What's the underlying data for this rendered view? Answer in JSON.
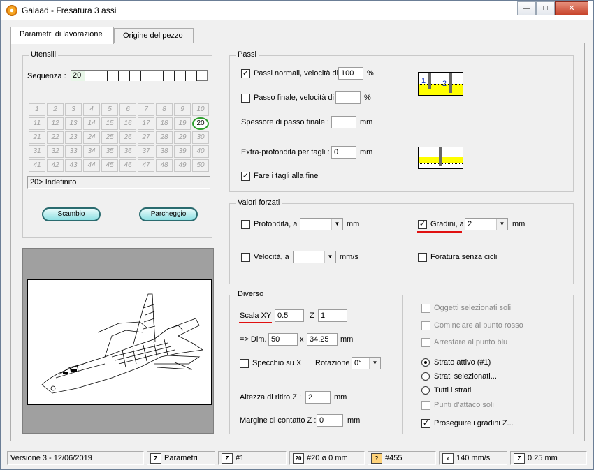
{
  "window": {
    "title": "Galaad  -  Fresatura 3 assi",
    "buttons": {
      "minimize": "—",
      "maximize": "□",
      "close": "✕"
    }
  },
  "tabs": [
    {
      "label": "Parametri di lavorazione",
      "active": true
    },
    {
      "label": "Origine del pezzo",
      "active": false
    }
  ],
  "utensili": {
    "title": "Utensili",
    "sequence_label": "Sequenza :",
    "sequence_value": "20",
    "tools": [
      "1",
      "2",
      "3",
      "4",
      "5",
      "6",
      "7",
      "8",
      "9",
      "10",
      "11",
      "12",
      "13",
      "14",
      "15",
      "16",
      "17",
      "18",
      "19",
      "20",
      "21",
      "22",
      "23",
      "24",
      "25",
      "26",
      "27",
      "28",
      "29",
      "30",
      "31",
      "32",
      "33",
      "34",
      "35",
      "36",
      "37",
      "38",
      "39",
      "40",
      "41",
      "42",
      "43",
      "44",
      "45",
      "46",
      "47",
      "48",
      "49",
      "50"
    ],
    "selected_tool": "20",
    "info": "20>  Indefinito",
    "btn_scambio": "Scambio",
    "btn_parcheggio": "Parcheggio"
  },
  "passi": {
    "title": "Passi",
    "normal_label": "Passi normali, velocità di",
    "normal_checked": true,
    "normal_value": "100",
    "normal_unit": "%",
    "final_label": "Passo finale, velocità di",
    "final_checked": false,
    "final_value": "",
    "final_unit": "%",
    "thickness_label": "Spessore di passo finale :",
    "thickness_value": "",
    "thickness_unit": "mm",
    "extra_label": "Extra-profondità per tagli :",
    "extra_value": "0",
    "extra_unit": "mm",
    "cuts_end_label": "Fare i tagli alla fine",
    "cuts_end_checked": true,
    "diagram_labels": [
      "1",
      "2"
    ]
  },
  "valori": {
    "title": "Valori forzati",
    "profondita_label": "Profondità, a",
    "profondita_checked": false,
    "profondita_value": "",
    "profondita_unit": "mm",
    "gradini_label": "Gradini, a",
    "gradini_checked": true,
    "gradini_value": "2",
    "gradini_unit": "mm",
    "velocita_label": "Velocità, a",
    "velocita_checked": false,
    "velocita_value": "",
    "velocita_unit": "mm/s",
    "foratura_label": "Foratura senza cicli",
    "foratura_checked": false
  },
  "diverso": {
    "title": "Diverso",
    "scala_label": "Scala XY",
    "scala_value": "0.5",
    "z_label": "Z",
    "z_value": "1",
    "dim_label": "=> Dim.",
    "dim_x": "50",
    "dim_sep": "x",
    "dim_y": "34.25",
    "dim_unit": "mm",
    "specchio_label": "Specchio su X",
    "specchio_checked": false,
    "rotazione_label": "Rotazione",
    "rotazione_value": "0°",
    "ritiro_label": "Altezza di ritiro Z :",
    "ritiro_value": "2",
    "ritiro_unit": "mm",
    "margine_label": "Margine di contatto Z :",
    "margine_value": "0",
    "margine_unit": "mm",
    "oggetti_label": "Oggetti selezionati soli",
    "cominciare_label": "Cominciare al punto rosso",
    "arrestare_label": "Arrestare al punto blu",
    "strato_attivo_label": "Strato attivo (#1)",
    "strati_sel_label": "Strati selezionati...",
    "tutti_label": "Tutti i strati",
    "punti_label": "Punti d'attaco soli",
    "proseguire_label": "Proseguire i gradini Z...",
    "proseguire_checked": true
  },
  "status": {
    "version": "Versione 3 - 12/06/2019",
    "parametri": "Parametri",
    "layer": "#1",
    "tool": "#20  ø 0 mm",
    "count": "#455",
    "speed": "140 mm/s",
    "step": "0.25 mm"
  },
  "colors": {
    "accent_red": "#e01010",
    "selected_tool_green": "#2ea02e",
    "button_cyan": "#8fe0e3",
    "diagram_yellow": "#ffff00"
  }
}
